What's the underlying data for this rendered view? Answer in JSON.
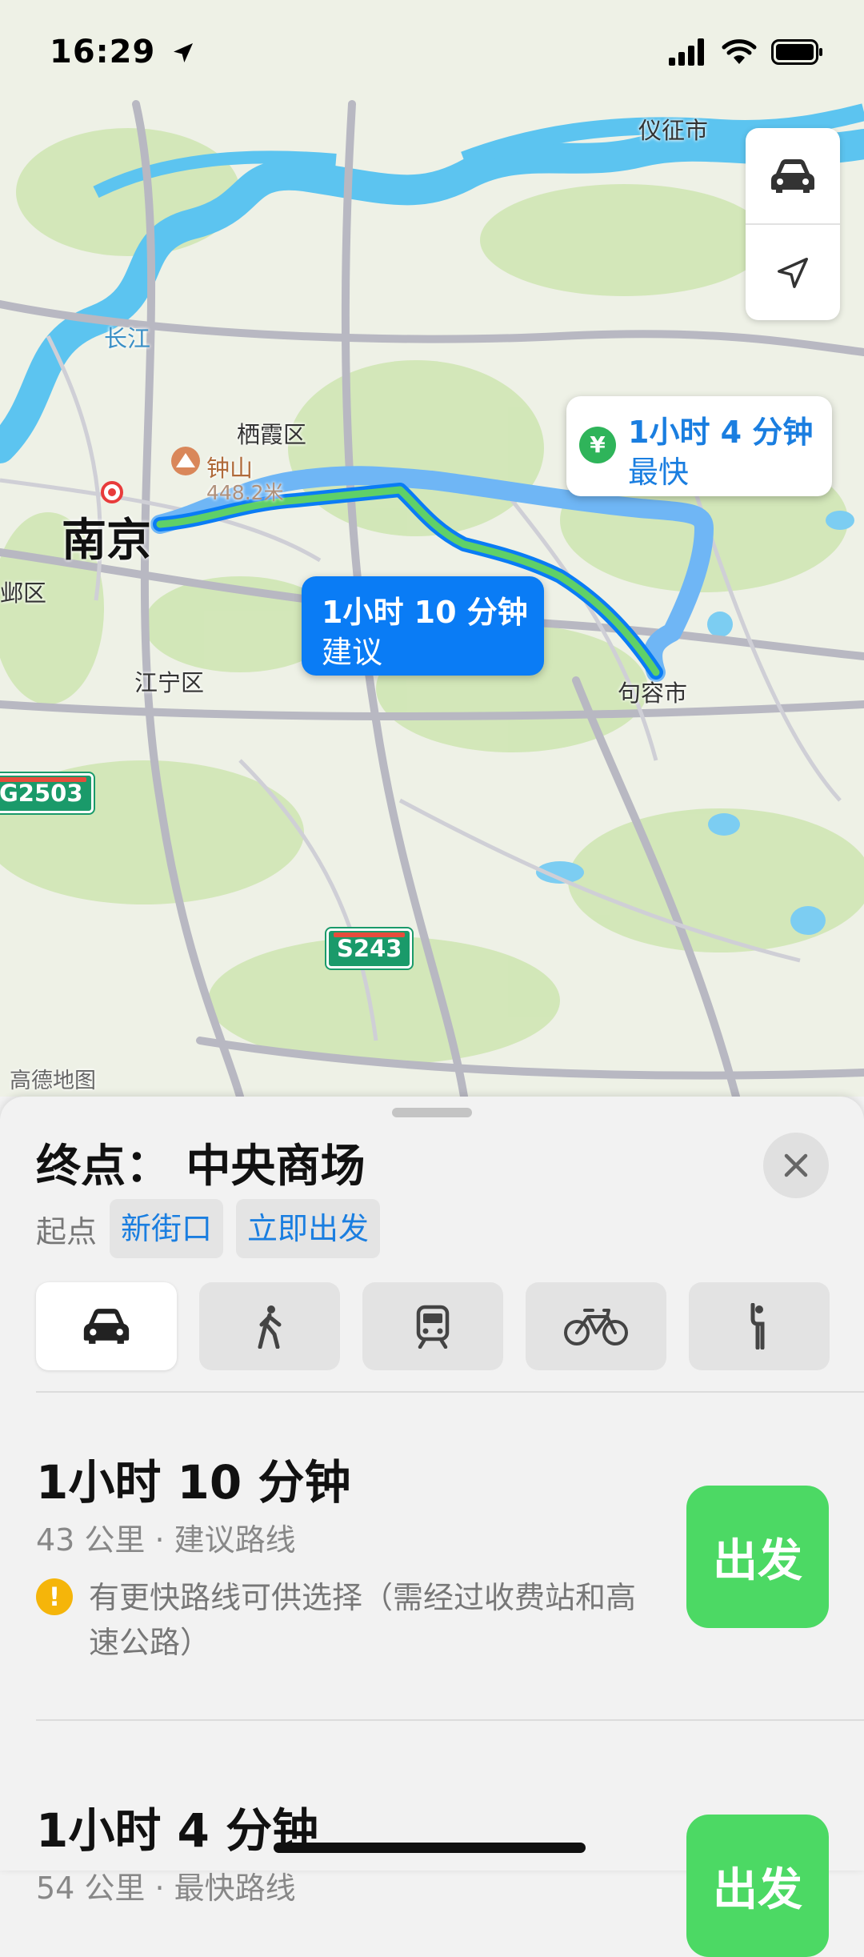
{
  "status_bar": {
    "time": "16:29"
  },
  "map": {
    "labels": {
      "yizheng": "仪征市",
      "changjiang": "长江",
      "qixia": "栖霞区",
      "zhongshan": "钟山",
      "zhongshan_elev": "448.2米",
      "nanjing": "南京",
      "youqu": "邺区",
      "jiangning": "江宁区",
      "jurong": "句容市",
      "attribution": "高德地图"
    },
    "shields": {
      "g2503": "G2503",
      "s243": "S243"
    },
    "callout_fastest": {
      "duration": "1小时 4 分钟",
      "label": "最快",
      "icon": "yen-icon"
    },
    "callout_suggested": {
      "duration": "1小时 10 分钟",
      "label": "建议"
    },
    "colors": {
      "route_active": "#0a7cf5",
      "route_alt": "#6fb6f5",
      "traffic": "#5fd068",
      "water": "#5cc4f0",
      "land": "#eef1e6"
    }
  },
  "sheet": {
    "destination": "终点：  中央商场",
    "origin_label": "起点",
    "origin_value": "新街口",
    "depart_value": "立即出发",
    "modes": [
      "car-icon",
      "walk-icon",
      "transit-icon",
      "bike-icon",
      "rideshare-icon"
    ],
    "routes": [
      {
        "time": "1小时 10 分钟",
        "meta": "43 公里 · 建议路线",
        "warning": "有更快路线可供选择（需经过收费站和高速公路）",
        "go": "出发"
      },
      {
        "time": "1小时 4 分钟",
        "meta": "54 公里 · 最快路线",
        "go": "出发"
      }
    ],
    "accent": "#4cd964"
  }
}
